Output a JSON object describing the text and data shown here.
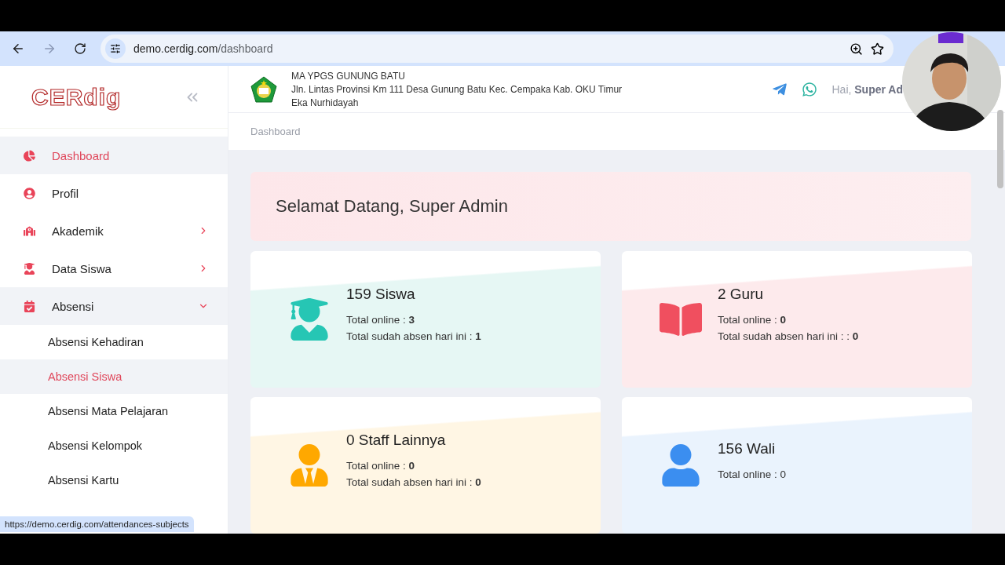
{
  "browser": {
    "url_host": "demo.cerdig.com",
    "url_path": "/dashboard"
  },
  "sidebar": {
    "logo": "CERdig",
    "items": [
      {
        "kind": "link",
        "label": "Dashboard",
        "selected": true
      },
      {
        "kind": "link",
        "label": "Profil",
        "selected": false
      },
      {
        "kind": "group",
        "label": "Akademik",
        "selected": false,
        "expanded": false
      },
      {
        "kind": "group",
        "label": "Data Siswa",
        "selected": false,
        "expanded": false
      },
      {
        "kind": "group",
        "label": "Absensi",
        "selected": false,
        "expanded": true,
        "children": [
          {
            "label": "Absensi Kehadiran",
            "selected": false
          },
          {
            "label": "Absensi Siswa",
            "selected": true
          },
          {
            "label": "Absensi Mata Pelajaran",
            "selected": false
          },
          {
            "label": "Absensi Kelompok",
            "selected": false
          },
          {
            "label": "Absensi Kartu",
            "selected": false
          }
        ]
      }
    ]
  },
  "header": {
    "school": "MA YPGS GUNUNG BATU",
    "address": "Jln. Lintas Provinsi Km 111 Desa Gunung Batu Kec. Cempaka Kab. OKU Timur",
    "person": "Eka Nurhidayah",
    "greeting": "Hai, **Super Ad**"
  },
  "breadcrumb": "Dashboard",
  "welcome": "Selamat Datang, Super Admin",
  "cards": [
    {
      "kind": "student",
      "title": "159 Siswa",
      "color": "#26c6b4",
      "lines": [
        "Total online : **3**",
        "Total sudah absen hari ini : **1**"
      ]
    },
    {
      "kind": "book",
      "title": "2 Guru",
      "color": "#f04f5f",
      "lines": [
        "Total online : **0**",
        "Total sudah absen hari ini : : **0**"
      ]
    },
    {
      "kind": "staff",
      "title": "0 Staff Lainnya",
      "color": "#ffa800",
      "lines": [
        "Total online : **0**",
        "Total sudah absen hari ini : **0**"
      ]
    },
    {
      "kind": "user",
      "title": "156 Wali",
      "color": "#3b8ef0",
      "lines": [
        "Total online : 0"
      ]
    }
  ],
  "status_url": "https://demo.cerdig.com/attendances-subjects"
}
